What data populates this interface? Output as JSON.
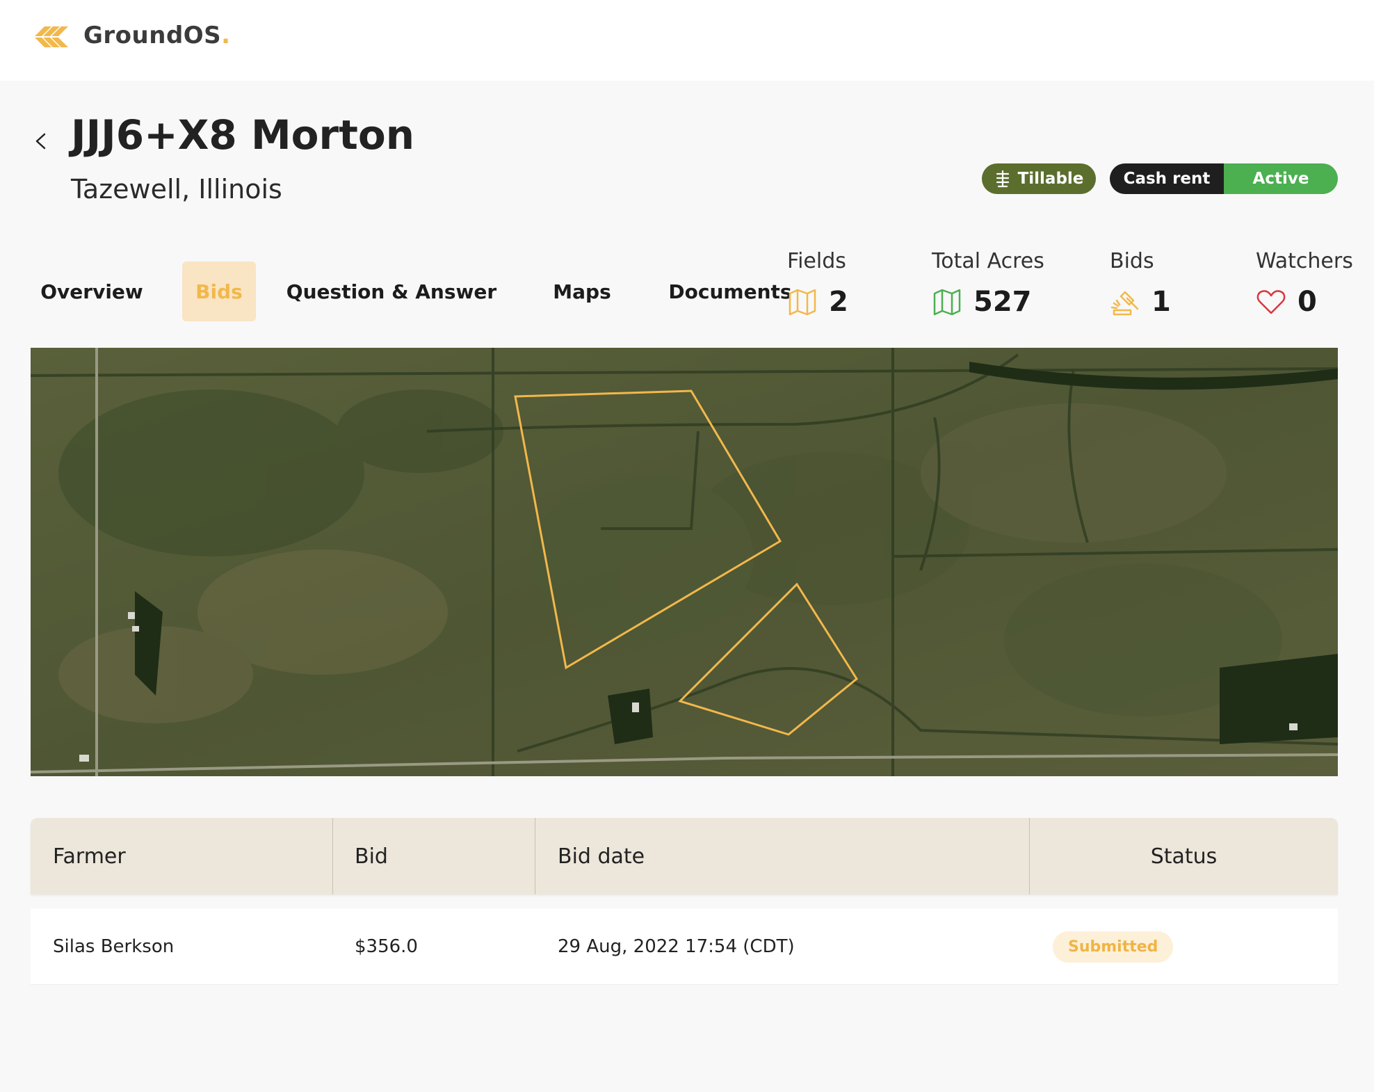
{
  "brand": {
    "name": "GroundOS",
    "mark": "."
  },
  "header": {
    "title": "JJJ6+X8 Morton",
    "subtitle": "Tazewell, Illinois"
  },
  "badges": {
    "tillable": "Tillable",
    "lease_type": "Cash rent",
    "status": "Active"
  },
  "tabs": [
    {
      "label": "Overview"
    },
    {
      "label": "Bids"
    },
    {
      "label": "Question & Answer"
    },
    {
      "label": "Maps"
    },
    {
      "label": "Documents"
    }
  ],
  "active_tab": "Bids",
  "stats": [
    {
      "label": "Fields",
      "value": "2",
      "icon": "map-icon",
      "color": "#f2b84b"
    },
    {
      "label": "Total Acres",
      "value": "527",
      "icon": "map-icon",
      "color": "#4caf50"
    },
    {
      "label": "Bids",
      "value": "1",
      "icon": "gavel-icon",
      "color": "#f2b84b"
    },
    {
      "label": "Watchers",
      "value": "0",
      "icon": "heart-icon",
      "color": "#d9363e"
    }
  ],
  "bids_table": {
    "columns": [
      "Farmer",
      "Bid",
      "Bid date",
      "Status"
    ],
    "rows": [
      {
        "farmer": "Silas Berkson",
        "bid": "$356.0",
        "bid_date": "29 Aug, 2022 17:54 (CDT)",
        "status": "Submitted"
      }
    ]
  },
  "colors": {
    "accent": "#f2b84b",
    "tillable_badge": "#5b6e2e",
    "active_badge": "#4caf50",
    "cash_rent_badge": "#1f1f1f",
    "table_header": "#ede6db",
    "field_outline": "#f2b84b"
  }
}
